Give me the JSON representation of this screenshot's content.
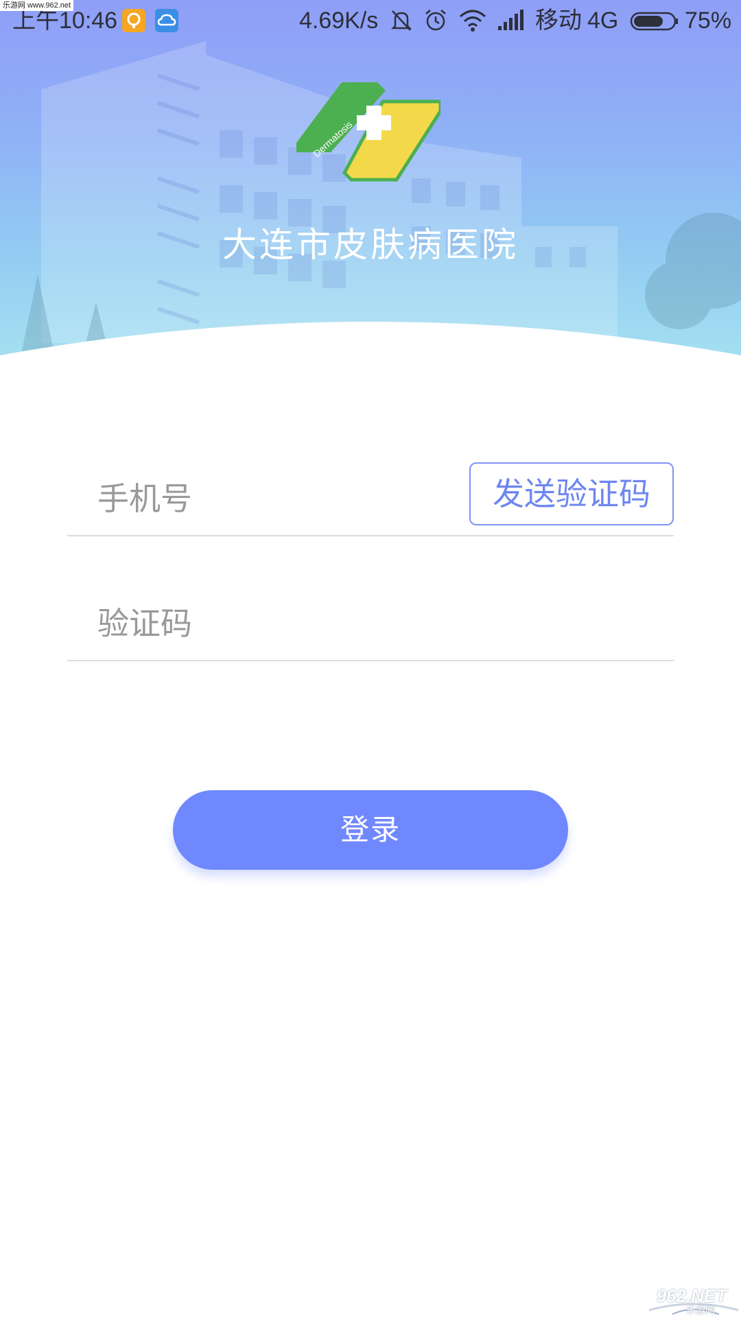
{
  "status_bar": {
    "time": "上午10:46",
    "net_speed": "4.69K/s",
    "carrier": "移动",
    "network": "4G",
    "battery": "75%",
    "battery_level": 0.75,
    "overlay_text": "乐游网 www.962.net",
    "icons": [
      "photo-app-icon",
      "cloud-app-icon",
      "mute-bell-icon",
      "alarm-icon",
      "wifi-icon",
      "signal-icon",
      "battery-icon"
    ]
  },
  "header": {
    "title": "大连市皮肤病医院",
    "logo_text": "Dermatosis"
  },
  "form": {
    "phone_placeholder": "手机号",
    "phone_value": "",
    "send_code_label": "发送验证码",
    "code_placeholder": "验证码",
    "code_value": ""
  },
  "login": {
    "label": "登录"
  },
  "watermark": {
    "brand": "962.NET",
    "sub": "乐游网"
  },
  "colors": {
    "accent": "#7088fd",
    "send_code_border": "#7f93f6",
    "logo_green": "#4caf50",
    "logo_yellow": "#f3d94a"
  }
}
